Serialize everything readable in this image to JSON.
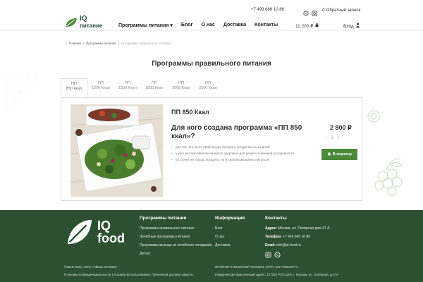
{
  "header": {
    "logo_iq": "IQ",
    "logo_sub": "питание",
    "phone": "+7 499 686 10 86",
    "callback": "Обратный звонок",
    "nav": [
      "Программы питания",
      "Блог",
      "О нас",
      "Доставка",
      "Контакты"
    ],
    "cart_price": "11 200 ₽",
    "login": "Вход"
  },
  "breadcrumb": [
    "Главная",
    "Программы питания",
    "Программы правильного питания"
  ],
  "page_title": "Программы правильного питания",
  "tabs": [
    {
      "line1": "ПП",
      "line2": "850 Ккал"
    },
    {
      "line1": "ПП",
      "line2": "1200 Ккал"
    },
    {
      "line1": "ПП",
      "line2": "1500 Ккал"
    },
    {
      "line1": "ПП",
      "line2": "1800 Ккал"
    },
    {
      "line1": "ПП",
      "line2": "2000 Ккал"
    },
    {
      "line1": "ПП",
      "line2": "2500 Ккал"
    }
  ],
  "product": {
    "title": "ПП 850 Ккал",
    "subtitle": "Для кого создана программа «ПП 850 ккал»?",
    "bullets": [
      "для тех, кто хочет пройти курс быстрого похудения за 10 дней!",
      "у кого нет противопоказаний по здоровью для резкого снижения калорийности",
      "кто хочет не только похудеть, но и сбалансированно питаться"
    ],
    "price": "2 800 ₽",
    "qty_minus": "−",
    "qty": "1",
    "qty_plus": "+",
    "cart_button": "В корзину"
  },
  "footer": {
    "logo_line1": "IQ",
    "logo_line2": "food",
    "col1_title": "Программы питания",
    "col1_links": [
      "Программы правильного питания",
      "Лечебные программы питания",
      "Программы выхода из лечебного голодания",
      "Детокс"
    ],
    "col2_title": "Информация",
    "col2_links": [
      "Блог",
      "О нас",
      "Доставка"
    ],
    "col3_title": "Контакты",
    "address_label": "Адрес:",
    "address": "Москва, ул. Полярная дом 37 А",
    "phone_label": "Телефон:",
    "phone": "+7 499 686 10 86",
    "email_label": "Email:",
    "email": "info@iq-food.ru",
    "copyright": "©2016-2022, ООО «Айкью питание»",
    "legal_links": "Политика конфиденциальности | Условия использования | Публичный договор оферты",
    "inn": "ИНН/КПП 9715403759/771501001 ОГРН 1217700534774",
    "legal_address": "Юридический фактический адрес: 127282 РОССИЯ, г. Москва, ул. Полярная, д.37А"
  },
  "colors": {
    "brand_green": "#4c8a3a",
    "footer_green": "#2d5033"
  }
}
